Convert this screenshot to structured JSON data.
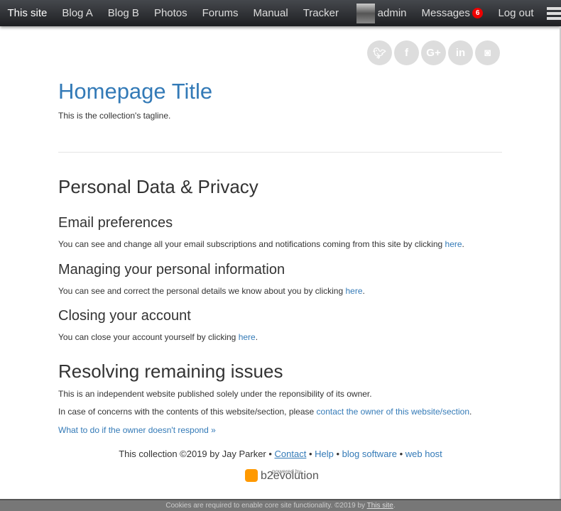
{
  "nav": {
    "items": [
      "This site",
      "Blog A",
      "Blog B",
      "Photos",
      "Forums",
      "Manual",
      "Tracker"
    ],
    "user": "admin",
    "messages": "Messages",
    "messages_count": "6",
    "logout": "Log out"
  },
  "social": {
    "twitter": "t",
    "facebook": "f",
    "googleplus": "G+",
    "linkedin": "in",
    "github": "gh"
  },
  "header": {
    "title": "Homepage Title",
    "tagline": "This is the collection's tagline."
  },
  "content": {
    "title": "Personal Data & Privacy",
    "email_h": "Email preferences",
    "email_p": "You can see and change all your email subscriptions and notifications coming from this site by clicking ",
    "here": "here",
    "manage_h": "Managing your personal information",
    "manage_p": "You can see and correct the personal details we know about you by clicking ",
    "close_h": "Closing your account",
    "close_p": "You can close your account yourself by clicking ",
    "resolve_h": "Resolving remaining issues",
    "resolve_p1": "This is an independent website published solely under the reponsibility of its owner.",
    "resolve_p2": "In case of concerns with the contents of this website/section, please ",
    "contact_owner": "contact the owner of this website/section",
    "what_to_do": "What to do if the owner doesn't respond »"
  },
  "footer": {
    "text": "This collection ©2019 by Jay Parker",
    "contact": "Contact",
    "help": "Help",
    "blog_software": "blog software",
    "web_host": "web host",
    "powered_by": "powered by",
    "b2evo": "b2evolution"
  },
  "cookie": {
    "text": "Cookies are required to enable core site functionality. ©2019 by ",
    "link": "This site"
  }
}
